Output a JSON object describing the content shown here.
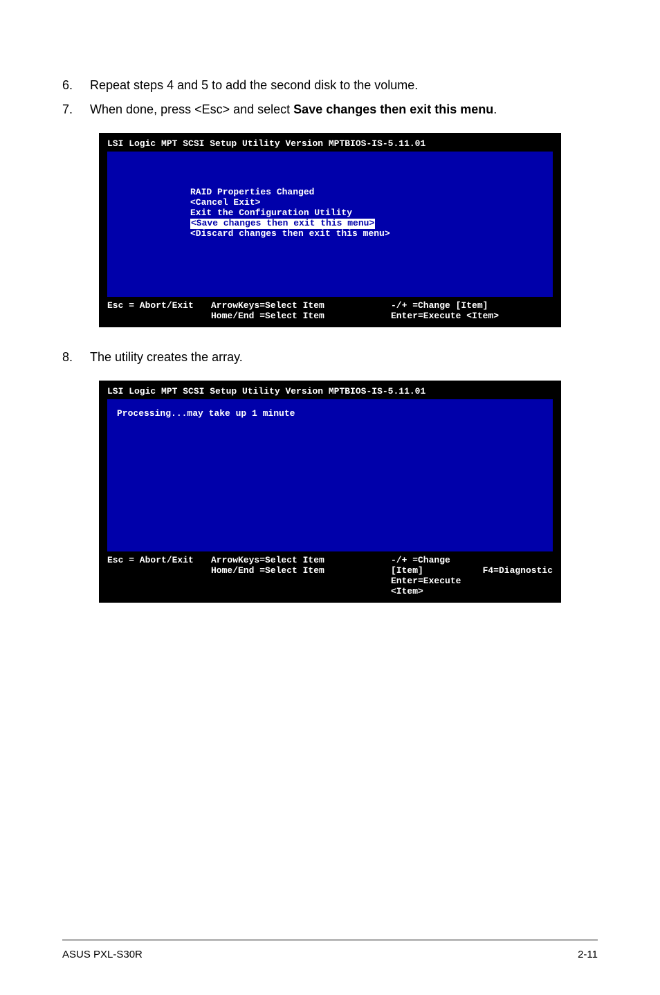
{
  "steps": {
    "six": {
      "num": "6.",
      "text": "Repeat steps 4 and 5 to add the second disk to the volume."
    },
    "seven": {
      "num": "7.",
      "text_a": "When done, press <Esc> and select ",
      "text_b": "Save changes then exit this menu",
      "text_c": "."
    },
    "eight": {
      "num": "8.",
      "text": "The utility creates the array."
    }
  },
  "bios1": {
    "header": "LSI Logic MPT SCSI Setup Utility   Version    MPTBIOS-IS-5.11.01",
    "lines": {
      "l1": "RAID Properties Changed",
      "l2": " <Cancel Exit>",
      "l3": " Exit the Configuration Utility",
      "l4": "  <Save changes then exit this menu>",
      "l5": "  <Discard changes then exit this menu>"
    },
    "footer": {
      "esc": "Esc = Abort/Exit",
      "arrows1": "ArrowKeys=Select Item",
      "arrows2": "Home/End =Select Item",
      "change": "-/+  =Change [Item]",
      "enter": "Enter=Execute <Item>"
    }
  },
  "bios2": {
    "header": "LSI Logic MPT SCSI Setup Utility   Version    MPTBIOS-IS-5.11.01",
    "processing": "Processing...may take up 1 minute",
    "footer": {
      "esc": "Esc = Abort/Exit",
      "arrows1": "ArrowKeys=Select Item",
      "arrows2": "Home/End =Select Item",
      "change": "-/+  =Change [Item]",
      "enter": "Enter=Execute <Item>",
      "diag": "F4=Diagnostic"
    }
  },
  "footer": {
    "left": "ASUS PXL-S30R",
    "right": "2-11"
  }
}
